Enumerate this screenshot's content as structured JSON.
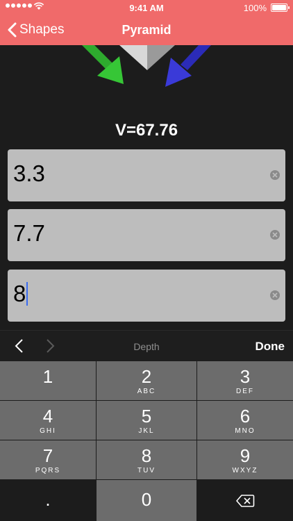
{
  "status": {
    "time": "9:41 AM",
    "battery": "100%"
  },
  "nav": {
    "back_label": "Shapes",
    "title": "Pyramid"
  },
  "result": {
    "volume": "V=67.76"
  },
  "fields": [
    {
      "value": "3.3"
    },
    {
      "value": "7.7"
    },
    {
      "value": "8"
    }
  ],
  "accessory": {
    "label": "Depth",
    "done": "Done"
  },
  "keypad": {
    "keys": [
      {
        "num": "1",
        "letters": ""
      },
      {
        "num": "2",
        "letters": "ABC"
      },
      {
        "num": "3",
        "letters": "DEF"
      },
      {
        "num": "4",
        "letters": "GHI"
      },
      {
        "num": "5",
        "letters": "JKL"
      },
      {
        "num": "6",
        "letters": "MNO"
      },
      {
        "num": "7",
        "letters": "PQRS"
      },
      {
        "num": "8",
        "letters": "TUV"
      },
      {
        "num": "9",
        "letters": "WXYZ"
      },
      {
        "num": ".",
        "letters": ""
      },
      {
        "num": "0",
        "letters": ""
      }
    ]
  },
  "colors": {
    "nav_bar": "#f06a6a",
    "field_bg": "#bdbdbd",
    "key_bg": "#6c6c6c",
    "caret": "#3a6cf0"
  },
  "icons": {
    "back": "chevron-left-icon",
    "clear": "clear-circle-icon",
    "delete": "backspace-icon",
    "prev": "chevron-left-icon",
    "next": "chevron-right-icon"
  }
}
